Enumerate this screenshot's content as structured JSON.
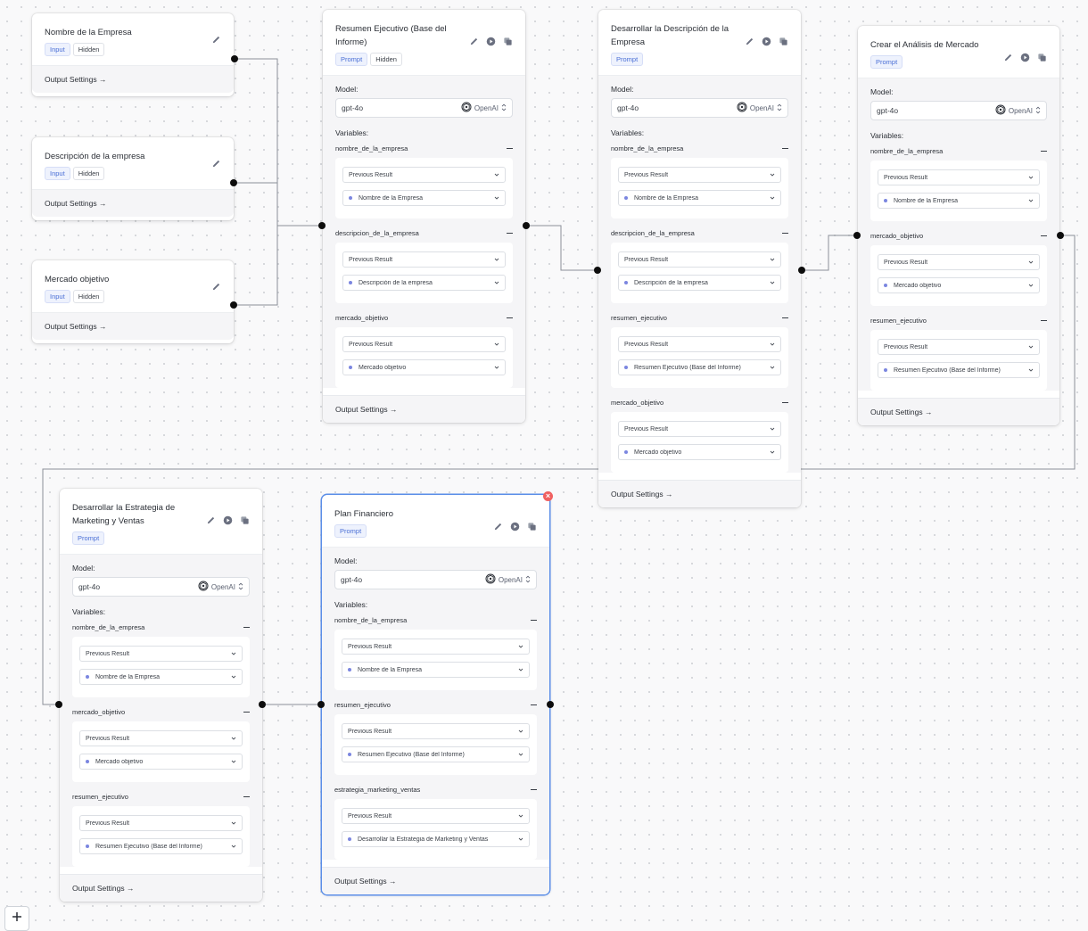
{
  "common": {
    "output_settings": "Output Settings →",
    "model_label": "Model:",
    "variables_label": "Variables:",
    "previous_result": "Previous Result",
    "provider": "OpenAI",
    "model_value": "gpt-4o"
  },
  "input_nodes": [
    {
      "title": "Nombre de la Empresa",
      "tags": [
        "Input",
        "Hidden"
      ]
    },
    {
      "title": "Descripción de la empresa",
      "tags": [
        "Input",
        "Hidden"
      ]
    },
    {
      "title": "Mercado objetivo",
      "tags": [
        "Input",
        "Hidden"
      ]
    }
  ],
  "prompt_nodes": [
    {
      "title": "Resumen Ejecutivo (Base del Informe)",
      "tags": [
        "Prompt",
        "Hidden"
      ],
      "variables": [
        {
          "name": "nombre_de_la_empresa",
          "source": "Nombre de la Empresa"
        },
        {
          "name": "descripcion_de_la_empresa",
          "source": "Descripción de la empresa"
        },
        {
          "name": "mercado_objetivo",
          "source": "Mercado objetivo"
        }
      ]
    },
    {
      "title": "Desarrollar la Descripción de la Empresa",
      "tags": [
        "Prompt"
      ],
      "variables": [
        {
          "name": "nombre_de_la_empresa",
          "source": "Nombre de la Empresa"
        },
        {
          "name": "descripcion_de_la_empresa",
          "source": "Descripción de la empresa"
        },
        {
          "name": "resumen_ejecutivo",
          "source": "Resumen Ejecutivo (Base del Informe)"
        },
        {
          "name": "mercado_objetivo",
          "source": "Mercado objetivo"
        }
      ]
    },
    {
      "title": "Crear el Análisis de Mercado",
      "tags": [
        "Prompt"
      ],
      "variables": [
        {
          "name": "nombre_de_la_empresa",
          "source": "Nombre de la Empresa"
        },
        {
          "name": "mercado_objetivo",
          "source": "Mercado objetivo"
        },
        {
          "name": "resumen_ejecutivo",
          "source": "Resumen Ejecutivo (Base del Informe)"
        }
      ]
    },
    {
      "title": "Desarrollar la Estrategia de Marketing y Ventas",
      "tags": [
        "Prompt"
      ],
      "variables": [
        {
          "name": "nombre_de_la_empresa",
          "source": "Nombre de la Empresa"
        },
        {
          "name": "mercado_objetivo",
          "source": "Mercado objetivo"
        },
        {
          "name": "resumen_ejecutivo",
          "source": "Resumen Ejecutivo (Base del Informe)"
        }
      ]
    },
    {
      "title": "Plan Financiero",
      "tags": [
        "Prompt"
      ],
      "variables": [
        {
          "name": "nombre_de_la_empresa",
          "source": "Nombre de la Empresa"
        },
        {
          "name": "resumen_ejecutivo",
          "source": "Resumen Ejecutivo (Base del Informe)"
        },
        {
          "name": "estrategia_marketing_ventas",
          "source": "Desarrollar la Estrategia de Marketing y Ventas"
        }
      ]
    }
  ],
  "colors": {
    "accent": "#4a6fd6",
    "selected_border": "#5b8ee8",
    "close": "#f06060",
    "source_dot": "#7b86e0"
  },
  "icons": [
    "pencil-icon",
    "play-icon",
    "copy-icon",
    "chevron-down-icon",
    "updown-chevron-icon",
    "openai-icon",
    "close-icon",
    "plus-icon",
    "minus-icon"
  ]
}
